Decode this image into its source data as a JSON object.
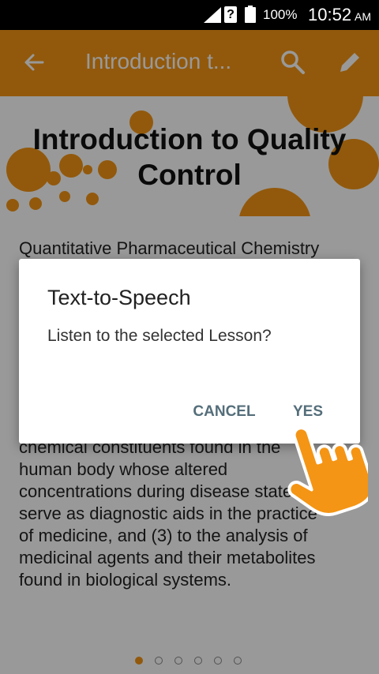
{
  "status_bar": {
    "battery": "100%",
    "time": "10:52",
    "ampm": "AM"
  },
  "app_bar": {
    "title": "Introduction t..."
  },
  "hero": {
    "title_line1": "Introduction to Quality",
    "title_line2": "Control"
  },
  "content": {
    "subtitle": "Quantitative Pharmaceutical Chemistry",
    "body_lines": [
      "chemical constituents found in the",
      "human body whose altered",
      "concentrations during disease  states",
      "serve as diagnostic aids in the practice",
      "of medicine, and (3) to the analysis of",
      "medicinal agents and their metabolites",
      "found in biological systems."
    ]
  },
  "dialog": {
    "title": "Text-to-Speech",
    "message": "Listen to the selected Lesson?",
    "cancel_label": "CANCEL",
    "yes_label": "YES"
  },
  "pager": {
    "total": 6,
    "active": 0
  },
  "colors": {
    "accent": "#f49515",
    "button_text": "#546e7a"
  },
  "icons": [
    "back-arrow-icon",
    "search-icon",
    "edit-pencil-icon",
    "hand-pointer-icon"
  ]
}
